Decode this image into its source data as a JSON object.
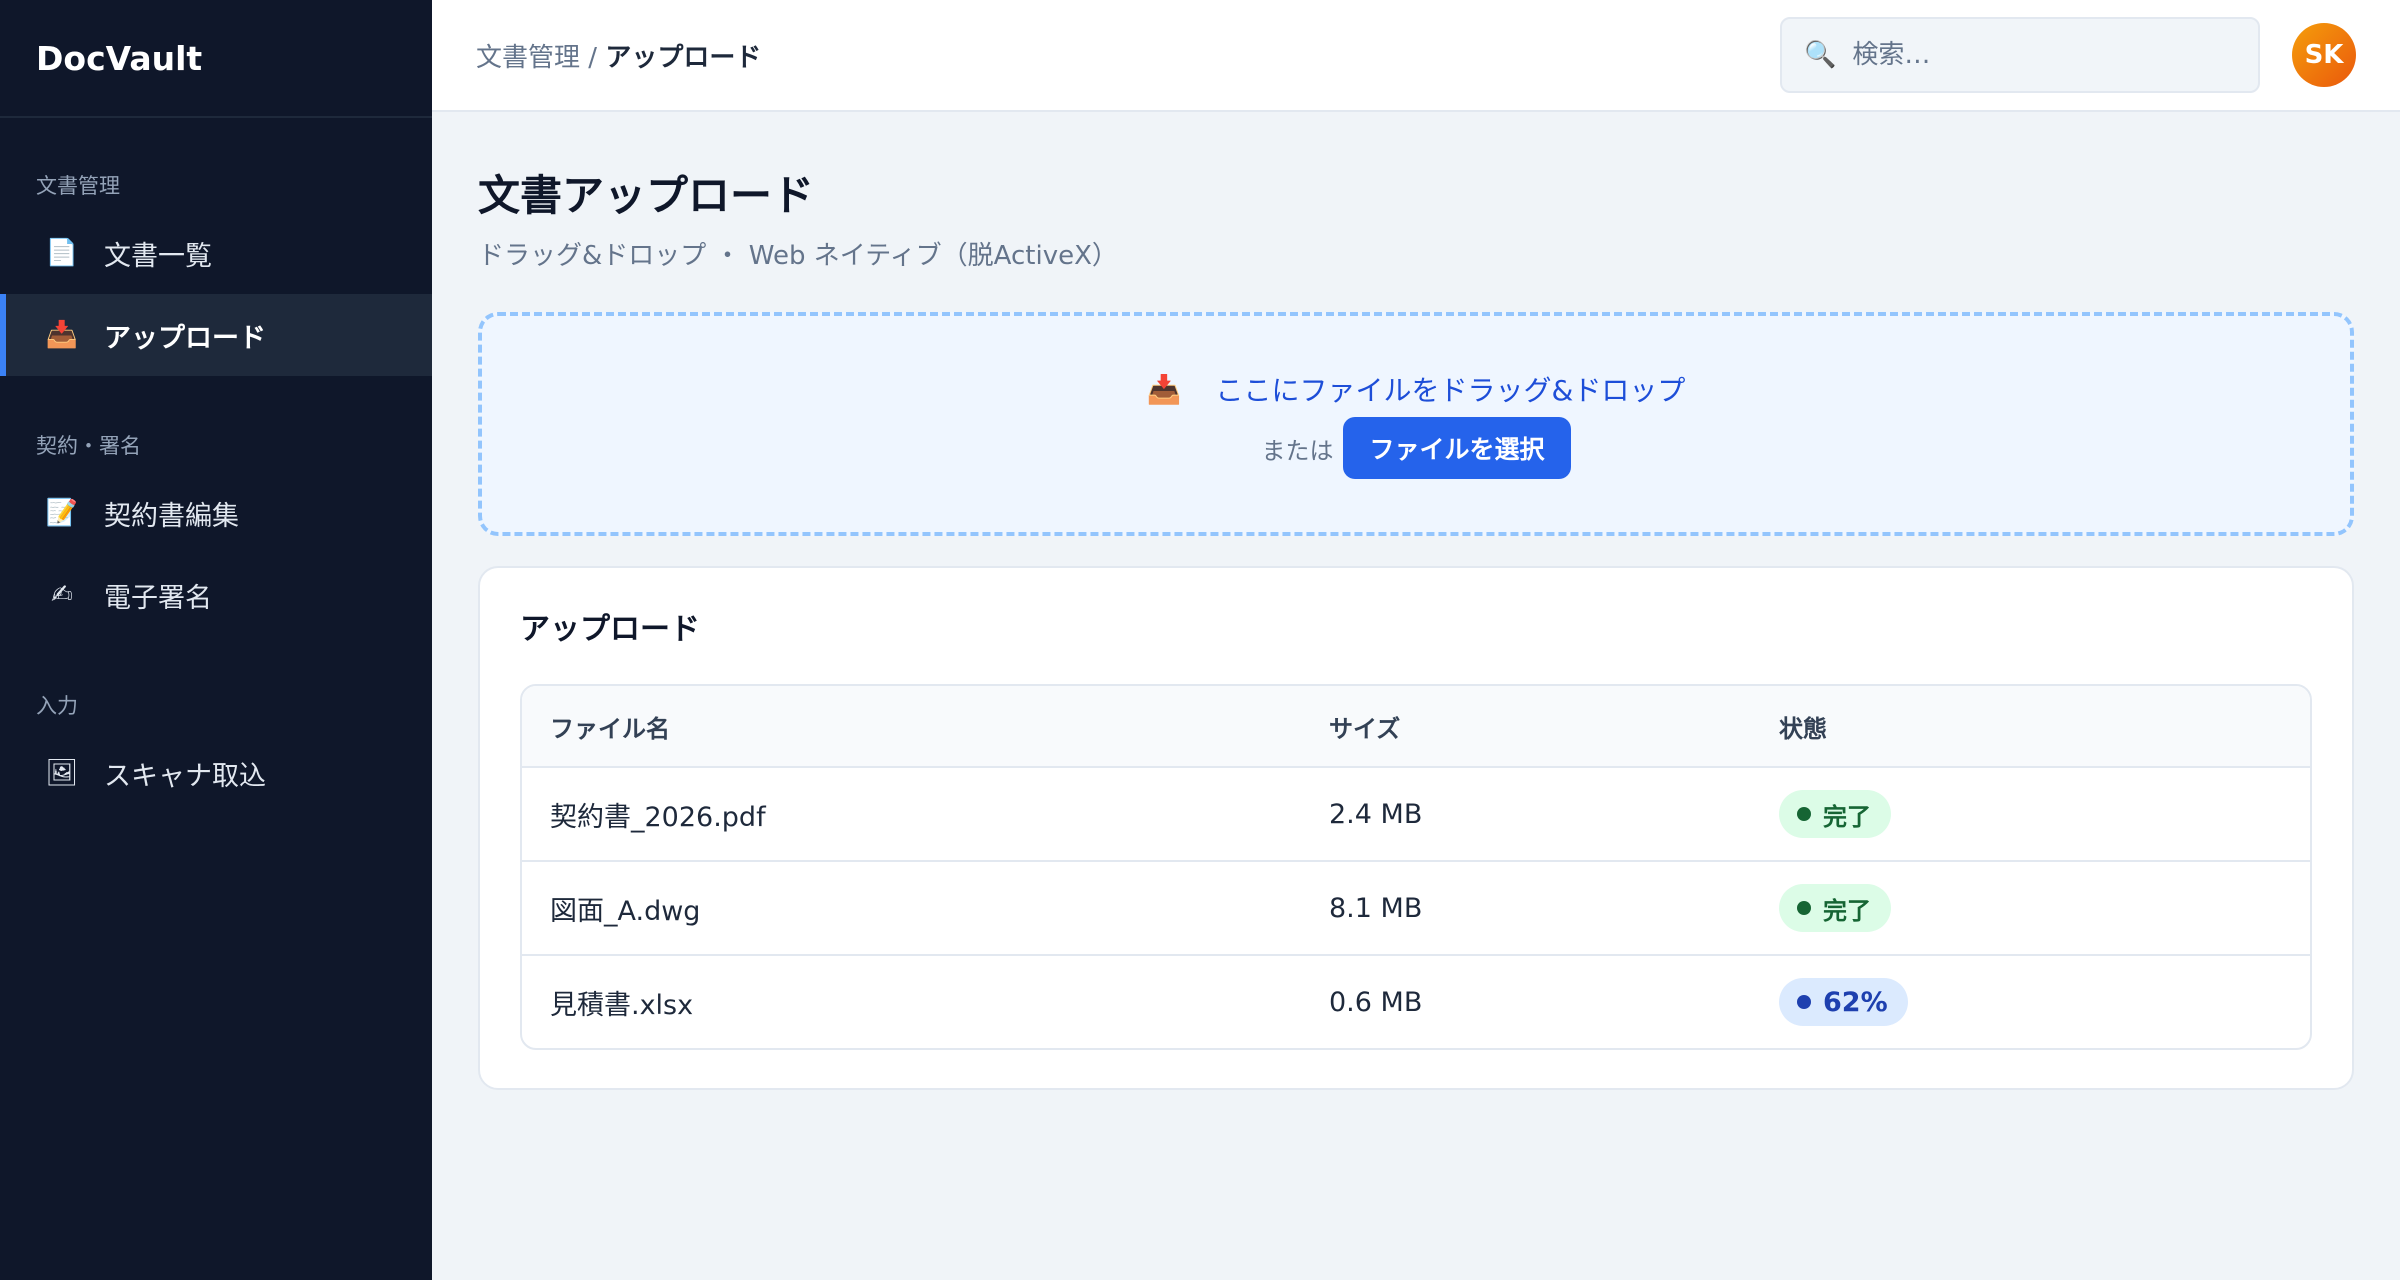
{
  "app": {
    "brand": "DocVault"
  },
  "sidebar": {
    "sections": [
      {
        "label": "文書管理",
        "items": [
          {
            "label": "文書一覧",
            "icon": "document-icon"
          },
          {
            "label": "アップロード",
            "icon": "inbox-upload-icon",
            "active": true
          }
        ]
      },
      {
        "label": "契約・署名",
        "items": [
          {
            "label": "契約書編集",
            "icon": "edit-document-icon"
          },
          {
            "label": "電子署名",
            "icon": "writing-hand-icon"
          }
        ]
      },
      {
        "label": "入力",
        "items": [
          {
            "label": "スキャナ取込",
            "icon": "picture-icon"
          }
        ]
      }
    ]
  },
  "header": {
    "breadcrumb_parent": "文書管理",
    "breadcrumb_sep": "/",
    "breadcrumb_current": "アップロード",
    "search_placeholder": "検索…",
    "avatar_initials": "SK"
  },
  "page": {
    "title": "文書アップロード",
    "subtitle": "ドラッグ&ドロップ ・ Web ネイティブ（脱ActiveX）"
  },
  "dropzone": {
    "text": "ここにファイルをドラッグ&ドロップ",
    "or": "または",
    "button": "ファイルを選択"
  },
  "uploads": {
    "title": "アップロード",
    "columns": [
      "ファイル名",
      "サイズ",
      "状態"
    ],
    "rows": [
      {
        "name": "契約書_2026.pdf",
        "size": "2.4 MB",
        "status": "完了",
        "kind": "done"
      },
      {
        "name": "図面_A.dwg",
        "size": "8.1 MB",
        "status": "完了",
        "kind": "done"
      },
      {
        "name": "見積書.xlsx",
        "size": "0.6 MB",
        "status": "62%",
        "kind": "progress"
      }
    ]
  },
  "colors": {
    "accent": "#2563eb",
    "sidebar_bg": "#0f172a",
    "done": "#166534",
    "progress": "#1e40af"
  }
}
